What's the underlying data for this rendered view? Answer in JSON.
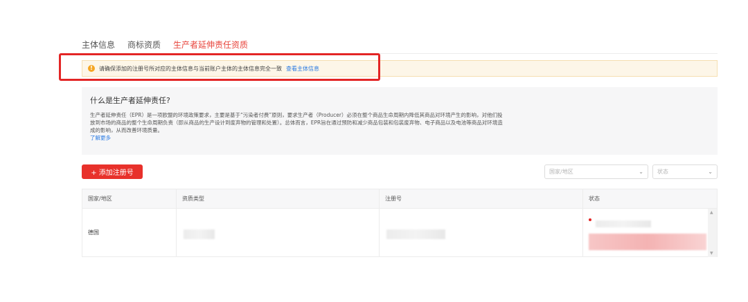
{
  "tabs": [
    {
      "label": "主体信息",
      "active": false
    },
    {
      "label": "商标资质",
      "active": false
    },
    {
      "label": "生产者延伸责任资质",
      "active": true
    }
  ],
  "alert": {
    "icon": "warning-icon",
    "text": "请确保添加的注册号所对应的主体信息与当前账户主体的主体信息完全一致",
    "link": "查看主体信息"
  },
  "info": {
    "title": "什么是生产者延伸责任?",
    "body": "生产者延伸责任（EPR）是一项欧盟的环境政策要求，主要是基于“污染者付费”原则，要求生产者（Producer）必须在整个商品生命周期内降低其商品对环境产生的影响，对他们投放到市场的商品的整个生命周期负责（即从商品的生产设计到废弃物的管理和处置）。总体而言，EPR旨在通过预防和减少商品包装和包装废弃物、电子商品以及电池等商品对环境造成的影响，从而改善环境质量。",
    "link": "了解更多"
  },
  "toolbar": {
    "add_button": "+ 添加注册号",
    "country_placeholder": "国家/地区",
    "status_placeholder": "状态"
  },
  "table": {
    "headers": [
      "国家/地区",
      "资质类型",
      "注册号",
      "状态"
    ],
    "rows": [
      {
        "country": "德国",
        "type": "",
        "reg_no": "",
        "status": ""
      }
    ]
  },
  "colors": {
    "accent": "#e8312b",
    "link": "#2a7ae2",
    "alert_bg": "#fdf6e8",
    "highlight": "#e32525"
  }
}
